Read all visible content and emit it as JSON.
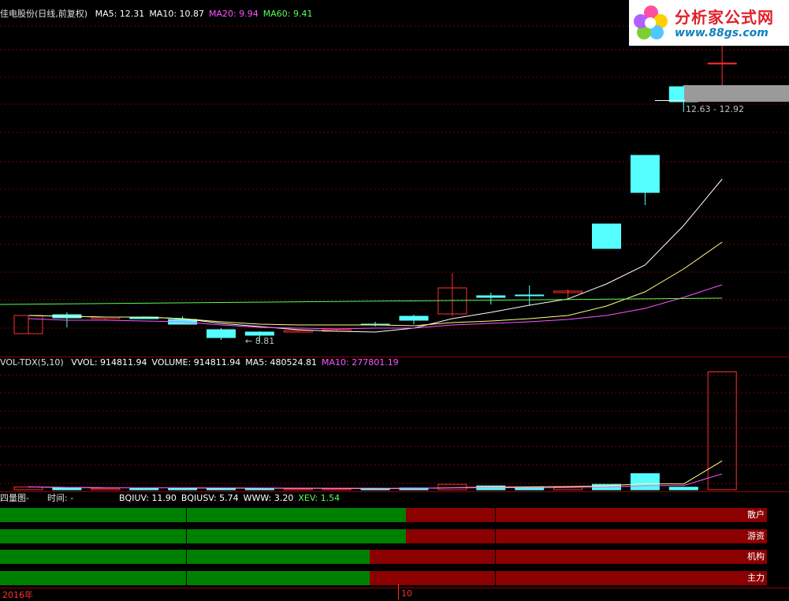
{
  "main": {
    "title": "佳电股份(日线,前复权)",
    "ma": [
      {
        "label": "MA5: 12.31",
        "color": "#ffffff"
      },
      {
        "label": "MA10: 10.87",
        "color": "#ffffff"
      },
      {
        "label": "MA20: 9.94",
        "color": "#ff55ff"
      },
      {
        "label": "MA60: 9.41",
        "color": "#55ff55"
      }
    ],
    "range_label": "12.63 - 12.92",
    "low_marker": "← 8.81"
  },
  "volume": {
    "title": "VOL-TDX(5,10)",
    "items": [
      {
        "label": "VVOL: 914811.94",
        "color": "#ffffff"
      },
      {
        "label": "VOLUME: 914811.94",
        "color": "#ffffff"
      },
      {
        "label": "MA5: 480524.81",
        "color": "#ffffff"
      },
      {
        "label": "MA10: 277801.19",
        "color": "#ff55ff"
      }
    ]
  },
  "energy": {
    "title": "四量图-",
    "time_label": "时间: -",
    "items": [
      {
        "label": "BQIUV: 11.90",
        "color": "#ffffff"
      },
      {
        "label": "BQIUSV: 5.74",
        "color": "#ffffff"
      },
      {
        "label": "WWW: 3.20",
        "color": "#ffffff"
      },
      {
        "label": "XEV: 1.54",
        "color": "#55ff55"
      }
    ],
    "bars": [
      {
        "label": "散户",
        "green": 0.545
      },
      {
        "label": "游资",
        "green": 0.545
      },
      {
        "label": "机构",
        "green": 0.496
      },
      {
        "label": "主力",
        "green": 0.496
      }
    ]
  },
  "xaxis": {
    "year": "2016年",
    "month": "10"
  },
  "logo": {
    "text": "分析家公式网",
    "url": "www.88gs.com"
  },
  "chart_data": [
    {
      "type": "candlestick",
      "title": "佳电股份(日线,前复权)",
      "x": [
        1,
        2,
        3,
        4,
        5,
        6,
        7,
        8,
        9,
        10,
        11,
        12,
        13,
        14,
        15,
        16,
        17,
        18,
        19
      ],
      "ohlc": [
        [
          8.93,
          9.16,
          8.93,
          9.18
        ],
        [
          9.19,
          9.22,
          9.01,
          9.14
        ],
        [
          9.13,
          9.13,
          9.11,
          9.15
        ],
        [
          9.15,
          9.16,
          9.14,
          9.13
        ],
        [
          9.12,
          9.16,
          9.12,
          9.06
        ],
        [
          8.98,
          9.0,
          8.84,
          8.87
        ],
        [
          8.95,
          8.96,
          8.81,
          8.9
        ],
        [
          8.95,
          8.96,
          8.95,
          8.97
        ],
        [
          8.96,
          8.99,
          8.96,
          8.98
        ],
        [
          9.06,
          9.09,
          9.02,
          9.05
        ],
        [
          9.16,
          9.19,
          9.06,
          9.11
        ],
        [
          9.2,
          9.76,
          9.16,
          9.55
        ],
        [
          9.45,
          9.49,
          9.33,
          9.42
        ],
        [
          9.46,
          9.59,
          9.32,
          9.45
        ],
        [
          9.49,
          9.53,
          9.39,
          9.51
        ],
        [
          10.43,
          10.43,
          10.1,
          10.1
        ],
        [
          11.37,
          11.37,
          10.69,
          10.86
        ],
        [
          12.31,
          12.33,
          11.96,
          12.11
        ],
        [
          12.63,
          12.92,
          12.25,
          12.63
        ]
      ],
      "ma_series": [
        {
          "name": "MA5",
          "last": 12.31
        },
        {
          "name": "MA10",
          "last": 10.87
        },
        {
          "name": "MA20",
          "last": 9.94
        },
        {
          "name": "MA60",
          "last": 9.41
        }
      ]
    },
    {
      "type": "bar",
      "title": "VOL-TDX(5,10)",
      "x": [
        1,
        2,
        3,
        4,
        5,
        6,
        7,
        8,
        9,
        10,
        11,
        12,
        13,
        14,
        15,
        16,
        17,
        18,
        19
      ],
      "values": [
        22000,
        14000,
        11000,
        14000,
        14000,
        11000,
        11000,
        8000,
        8000,
        9000,
        14000,
        42000,
        30000,
        20000,
        19000,
        42000,
        125000,
        20000,
        914811.94
      ],
      "series": [
        {
          "name": "MA5",
          "last": 480524.81
        },
        {
          "name": "MA10",
          "last": 277801.19
        }
      ]
    }
  ]
}
